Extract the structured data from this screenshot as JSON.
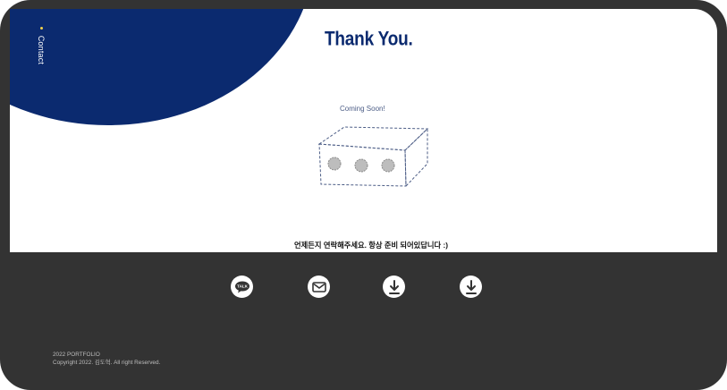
{
  "nav": {
    "contact_label": "Contact"
  },
  "main": {
    "title": "Thank You.",
    "coming_soon": "Coming Soon!",
    "message": "언제든지 연락해주세요. 항상 준비 되어있답니다 :)"
  },
  "footer": {
    "icons": [
      {
        "name": "kakaotalk-icon",
        "label": "TALK"
      },
      {
        "name": "mail-icon"
      },
      {
        "name": "download-icon"
      },
      {
        "name": "download-icon"
      }
    ],
    "portfolio_label": "2022 PORTFOLIO",
    "copyright": "Copyright 2022. 김도혁. All right Reserved."
  },
  "colors": {
    "navy": "#0b2a6f",
    "dark": "#333333",
    "white": "#ffffff",
    "accent_dot": "#f2d24b"
  }
}
